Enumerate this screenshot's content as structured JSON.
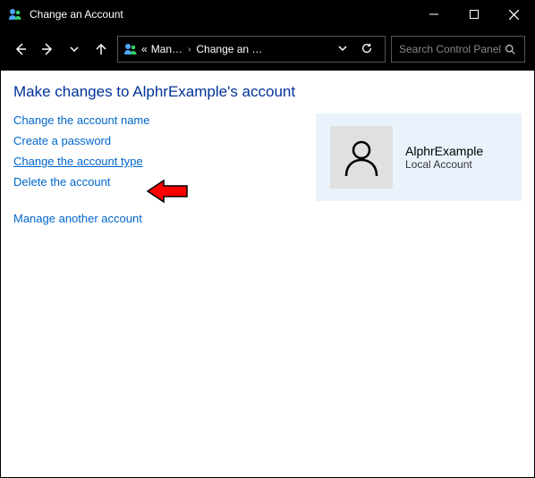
{
  "window": {
    "title": "Change an Account"
  },
  "breadcrumb": {
    "prefix": "«",
    "item1": "Man…",
    "item2": "Change an …"
  },
  "search": {
    "placeholder": "Search Control Panel"
  },
  "page": {
    "heading": "Make changes to AlphrExample's account"
  },
  "links": {
    "change_name": "Change the account name",
    "create_password": "Create a password",
    "change_type": "Change the account type",
    "delete_account": "Delete the account",
    "manage_another": "Manage another account"
  },
  "account": {
    "name": "AlphrExample",
    "type": "Local Account"
  }
}
